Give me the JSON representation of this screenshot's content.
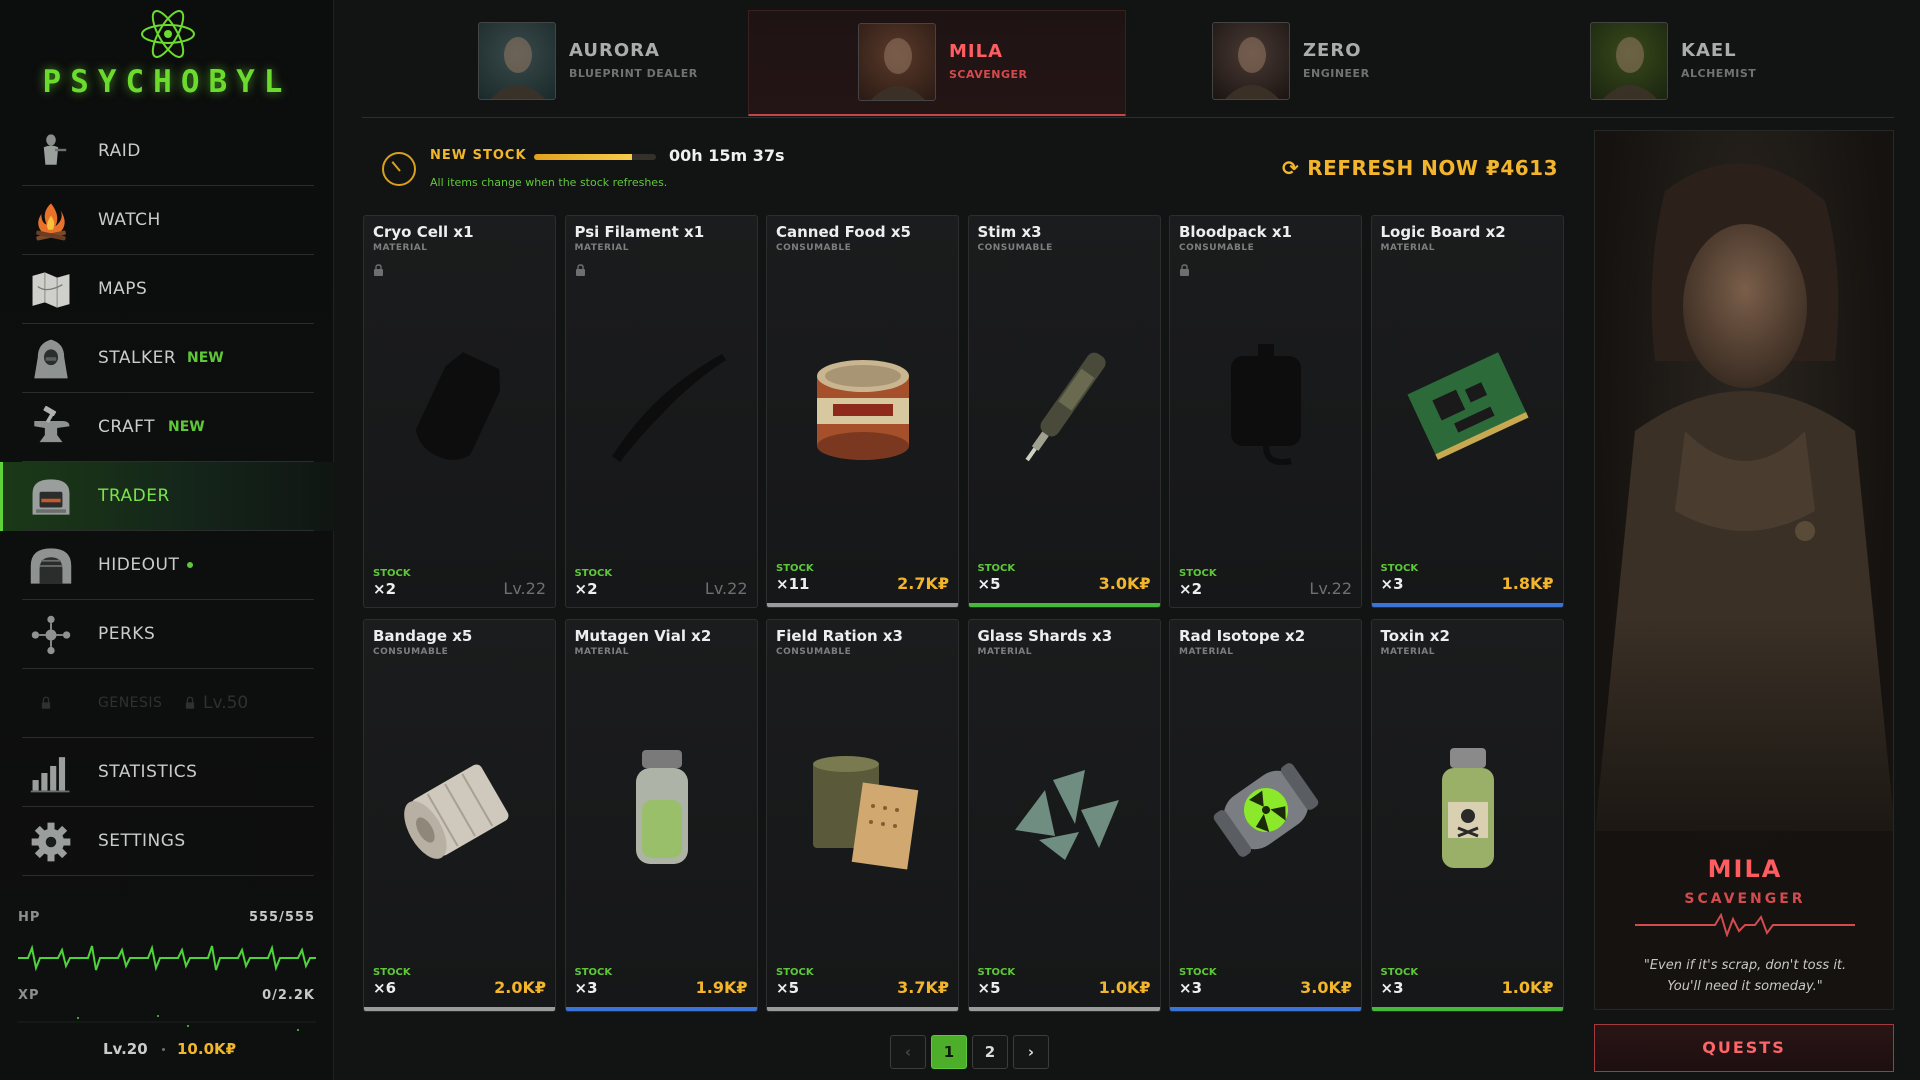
{
  "brand": {
    "name": "PSYCHOBYL"
  },
  "colors": {
    "accent_green": "#5fc83a",
    "accent_gold": "#f3b52c",
    "accent_red": "#ff5c60",
    "rarity_common": "#9a9c9b",
    "rarity_uncommon": "#46b83a",
    "rarity_rare": "#3a74d6"
  },
  "nav": [
    {
      "label": "RAID",
      "icon": "raid-figure-icon",
      "badge": ""
    },
    {
      "label": "WATCH",
      "icon": "campfire-icon",
      "badge": ""
    },
    {
      "label": "MAPS",
      "icon": "map-icon",
      "badge": ""
    },
    {
      "label": "STALKER",
      "icon": "hooded-stalker-icon",
      "badge": "NEW"
    },
    {
      "label": "CRAFT",
      "icon": "anvil-icon",
      "badge": "NEW"
    },
    {
      "label": "TRADER",
      "icon": "vendor-booth-icon",
      "badge": "",
      "active": true
    },
    {
      "label": "HIDEOUT",
      "icon": "bunker-icon",
      "badge": "",
      "dot": true
    },
    {
      "label": "PERKS",
      "icon": "perk-tree-icon",
      "badge": ""
    },
    {
      "label": "GENESIS",
      "icon": "lock-icon",
      "badge": "",
      "locked": true,
      "lock_level": "Lv.50"
    },
    {
      "label": "STATISTICS",
      "icon": "bar-chart-icon",
      "badge": ""
    },
    {
      "label": "SETTINGS",
      "icon": "gear-icon",
      "badge": ""
    }
  ],
  "player": {
    "hp_label": "HP",
    "hp_value": "555/555",
    "xp_label": "XP",
    "xp_value": "0/2.2K",
    "level": "Lv.20",
    "credits": "10.0K₽"
  },
  "traders": [
    {
      "name": "AURORA",
      "role": "BLUEPRINT DEALER",
      "active": false
    },
    {
      "name": "MILA",
      "role": "SCAVENGER",
      "active": true
    },
    {
      "name": "ZERO",
      "role": "ENGINEER",
      "active": false
    },
    {
      "name": "KAEL",
      "role": "ALCHEMIST",
      "active": false
    }
  ],
  "stock": {
    "label": "NEW STOCK",
    "progress": 0.8,
    "timer": "00h 15m 37s",
    "subtitle": "All items change when the stock refreshes.",
    "refresh_label": "REFRESH NOW ₽4613"
  },
  "items": [
    {
      "name": "Cryo Cell x1",
      "category": "MATERIAL",
      "stock_label": "STOCK",
      "stock": "×2",
      "locked": true,
      "level": "Lv.22",
      "price": "",
      "rarity": "none",
      "icon": "cryo-cell-icon"
    },
    {
      "name": "Psi Filament x1",
      "category": "MATERIAL",
      "stock_label": "STOCK",
      "stock": "×2",
      "locked": true,
      "level": "Lv.22",
      "price": "",
      "rarity": "none",
      "icon": "psi-filament-icon"
    },
    {
      "name": "Canned Food x5",
      "category": "CONSUMABLE",
      "stock_label": "STOCK",
      "stock": "×11",
      "locked": false,
      "level": "",
      "price": "2.7K₽",
      "rarity": "common",
      "icon": "canned-food-icon"
    },
    {
      "name": "Stim x3",
      "category": "CONSUMABLE",
      "stock_label": "STOCK",
      "stock": "×5",
      "locked": false,
      "level": "",
      "price": "3.0K₽",
      "rarity": "uncommon",
      "icon": "stim-syringe-icon"
    },
    {
      "name": "Bloodpack x1",
      "category": "CONSUMABLE",
      "stock_label": "STOCK",
      "stock": "×2",
      "locked": true,
      "level": "Lv.22",
      "price": "",
      "rarity": "none",
      "icon": "bloodpack-icon"
    },
    {
      "name": "Logic Board x2",
      "category": "MATERIAL",
      "stock_label": "STOCK",
      "stock": "×3",
      "locked": false,
      "level": "",
      "price": "1.8K₽",
      "rarity": "rare",
      "icon": "circuit-board-icon"
    },
    {
      "name": "Bandage x5",
      "category": "CONSUMABLE",
      "stock_label": "STOCK",
      "stock": "×6",
      "locked": false,
      "level": "",
      "price": "2.0K₽",
      "rarity": "common",
      "icon": "bandage-roll-icon"
    },
    {
      "name": "Mutagen Vial x2",
      "category": "MATERIAL",
      "stock_label": "STOCK",
      "stock": "×3",
      "locked": false,
      "level": "",
      "price": "1.9K₽",
      "rarity": "rare",
      "icon": "mutagen-vial-icon"
    },
    {
      "name": "Field Ration x3",
      "category": "CONSUMABLE",
      "stock_label": "STOCK",
      "stock": "×5",
      "locked": false,
      "level": "",
      "price": "3.7K₽",
      "rarity": "common",
      "icon": "field-ration-icon"
    },
    {
      "name": "Glass Shards x3",
      "category": "MATERIAL",
      "stock_label": "STOCK",
      "stock": "×5",
      "locked": false,
      "level": "",
      "price": "1.0K₽",
      "rarity": "common",
      "icon": "glass-shards-icon"
    },
    {
      "name": "Rad Isotope x2",
      "category": "MATERIAL",
      "stock_label": "STOCK",
      "stock": "×3",
      "locked": false,
      "level": "",
      "price": "3.0K₽",
      "rarity": "rare",
      "icon": "rad-isotope-icon"
    },
    {
      "name": "Toxin x2",
      "category": "MATERIAL",
      "stock_label": "STOCK",
      "stock": "×3",
      "locked": false,
      "level": "",
      "price": "1.0K₽",
      "rarity": "uncommon",
      "icon": "toxin-bottle-icon"
    }
  ],
  "pagination": {
    "prev": "‹",
    "pages": [
      "1",
      "2"
    ],
    "current": "1",
    "next": "›"
  },
  "trader_panel": {
    "name": "MILA",
    "role": "SCAVENGER",
    "quote_line1": "\"Even if it's scrap, don't toss it.",
    "quote_line2": "You'll need it someday.\"",
    "quests_label": "QUESTS"
  }
}
